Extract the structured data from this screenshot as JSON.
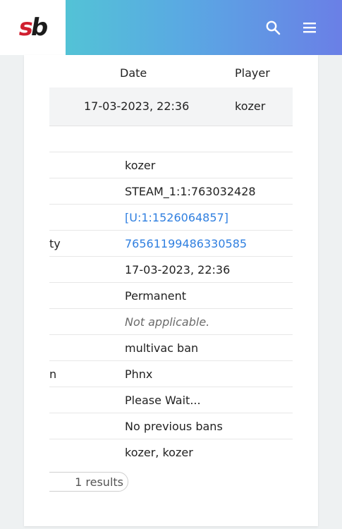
{
  "header": {
    "logo_left": "s",
    "logo_right": "b",
    "search_icon": "search-icon",
    "menu_icon": "hamburger-menu-icon",
    "colors": {
      "gradient_start": "#4fd1cf",
      "gradient_end": "#6a7fe6",
      "logo_red": "#d01f2f"
    }
  },
  "table": {
    "columns": {
      "date": "Date",
      "player": "Player"
    },
    "row": {
      "date": "17-03-2023, 22:36",
      "player": "kozer"
    }
  },
  "details": [
    {
      "label": "",
      "value": "kozer",
      "style": "plain"
    },
    {
      "label": "",
      "value": "STEAM_1:1:763032428",
      "style": "plain"
    },
    {
      "label": "",
      "value": "[U:1:1526064857]",
      "style": "link"
    },
    {
      "label": "ty",
      "value": "76561199486330585",
      "style": "link"
    },
    {
      "label": "",
      "value": "17-03-2023, 22:36",
      "style": "plain"
    },
    {
      "label": "",
      "value": "Permanent",
      "style": "plain"
    },
    {
      "label": "",
      "value": "Not applicable.",
      "style": "muted"
    },
    {
      "label": "",
      "value": "multivac ban",
      "style": "plain"
    },
    {
      "label": "n",
      "value": "Phnx",
      "style": "plain"
    },
    {
      "label": "",
      "value": "Please Wait...",
      "style": "plain"
    },
    {
      "label": "",
      "value": "No previous bans",
      "style": "plain"
    },
    {
      "label": "",
      "value": "kozer, kozer",
      "style": "plain"
    }
  ],
  "results_pill": {
    "text": "1 results"
  },
  "link_color": "#2f7fe0"
}
